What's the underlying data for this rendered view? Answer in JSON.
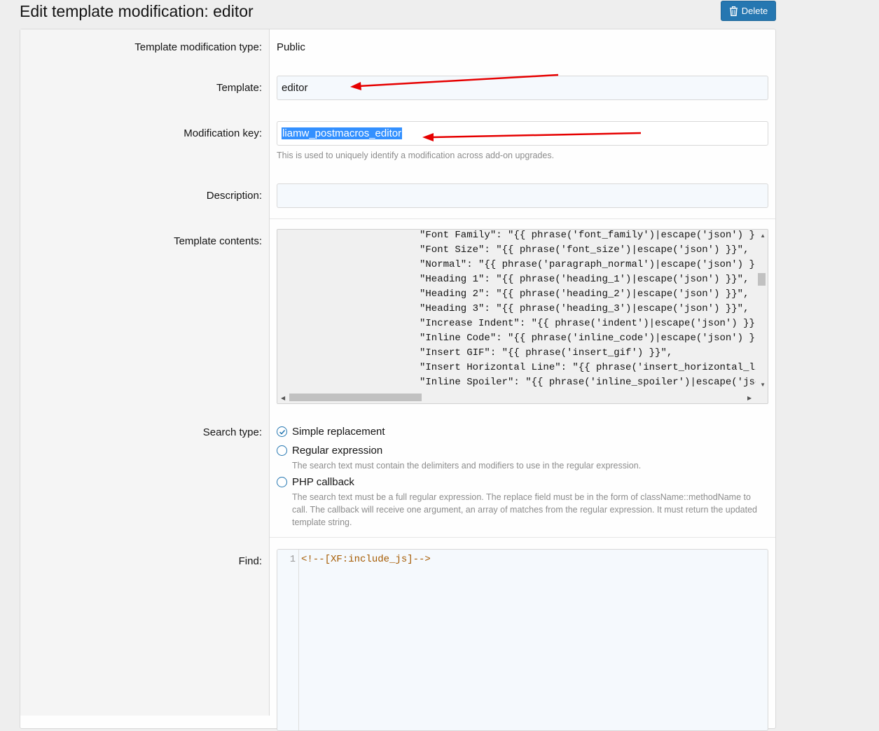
{
  "page": {
    "title": "Edit template modification: editor"
  },
  "toolbar": {
    "delete_label": "Delete",
    "delete_icon": "trash-icon"
  },
  "form": {
    "type_label": "Template modification type:",
    "type_value": "Public",
    "template_label": "Template:",
    "template_value": "editor",
    "key_label": "Modification key:",
    "key_value": "liamw_postmacros_editor",
    "key_hint": "This is used to uniquely identify a modification across add-on upgrades.",
    "description_label": "Description:",
    "description_value": "",
    "contents_label": "Template contents:",
    "contents_lines": [
      "\"Font Family\": \"{{ phrase('font_family')|escape('json') }}\",",
      "\"Font Size\": \"{{ phrase('font_size')|escape('json') }}\",",
      "\"Normal\": \"{{ phrase('paragraph_normal')|escape('json') }}\",",
      "\"Heading 1\": \"{{ phrase('heading_1')|escape('json') }}\",",
      "\"Heading 2\": \"{{ phrase('heading_2')|escape('json') }}\",",
      "\"Heading 3\": \"{{ phrase('heading_3')|escape('json') }}\",",
      "\"Increase Indent\": \"{{ phrase('indent')|escape('json') }}\",",
      "\"Inline Code\": \"{{ phrase('inline_code')|escape('json') }}\",",
      "\"Insert GIF\": \"{{ phrase('insert_gif') }}\",",
      "\"Insert Horizontal Line\": \"{{ phrase('insert_horizontal_line')|escape('json') }}\",",
      "\"Inline Spoiler\": \"{{ phrase('inline_spoiler')|escape('json') }}\","
    ],
    "search_type_label": "Search type:",
    "search_options": [
      {
        "label": "Simple replacement",
        "selected": true,
        "hint": ""
      },
      {
        "label": "Regular expression",
        "selected": false,
        "hint": "The search text must contain the delimiters and modifiers to use in the regular expression."
      },
      {
        "label": "PHP callback",
        "selected": false,
        "hint": "The search text must be a full regular expression. The replace field must be in the form of className::methodName to call. The callback will receive one argument, an array of matches from the regular expression. It must return the updated template string."
      }
    ],
    "find_label": "Find:",
    "find_line_number": "1",
    "find_value": "<!--[XF:include_js]-->"
  },
  "colors": {
    "accent": "#2577b1",
    "annotation_arrow": "#e60000",
    "selection": "#3390ff"
  }
}
